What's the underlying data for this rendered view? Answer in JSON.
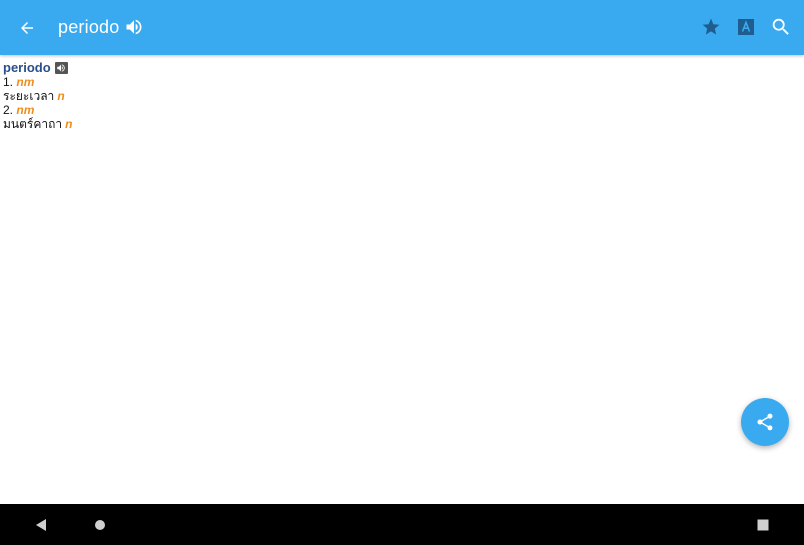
{
  "appbar": {
    "title": "periodo",
    "icons": [
      "back-arrow-icon",
      "speaker-icon",
      "star-icon",
      "translate-icon",
      "search-icon"
    ]
  },
  "entry": {
    "headword": "periodo",
    "senses": [
      {
        "number": "1.",
        "pos": "nm",
        "gloss": "ระยะเวลา",
        "gloss_pos": "n"
      },
      {
        "number": "2.",
        "pos": "nm",
        "gloss": "มนตร์คาถา",
        "gloss_pos": "n"
      }
    ]
  },
  "fab": {
    "icon": "share-icon"
  },
  "colors": {
    "appbar": "#39a9f0",
    "headword": "#2a4f8f",
    "pos": "#f08c1a",
    "navbar": "#000000"
  }
}
